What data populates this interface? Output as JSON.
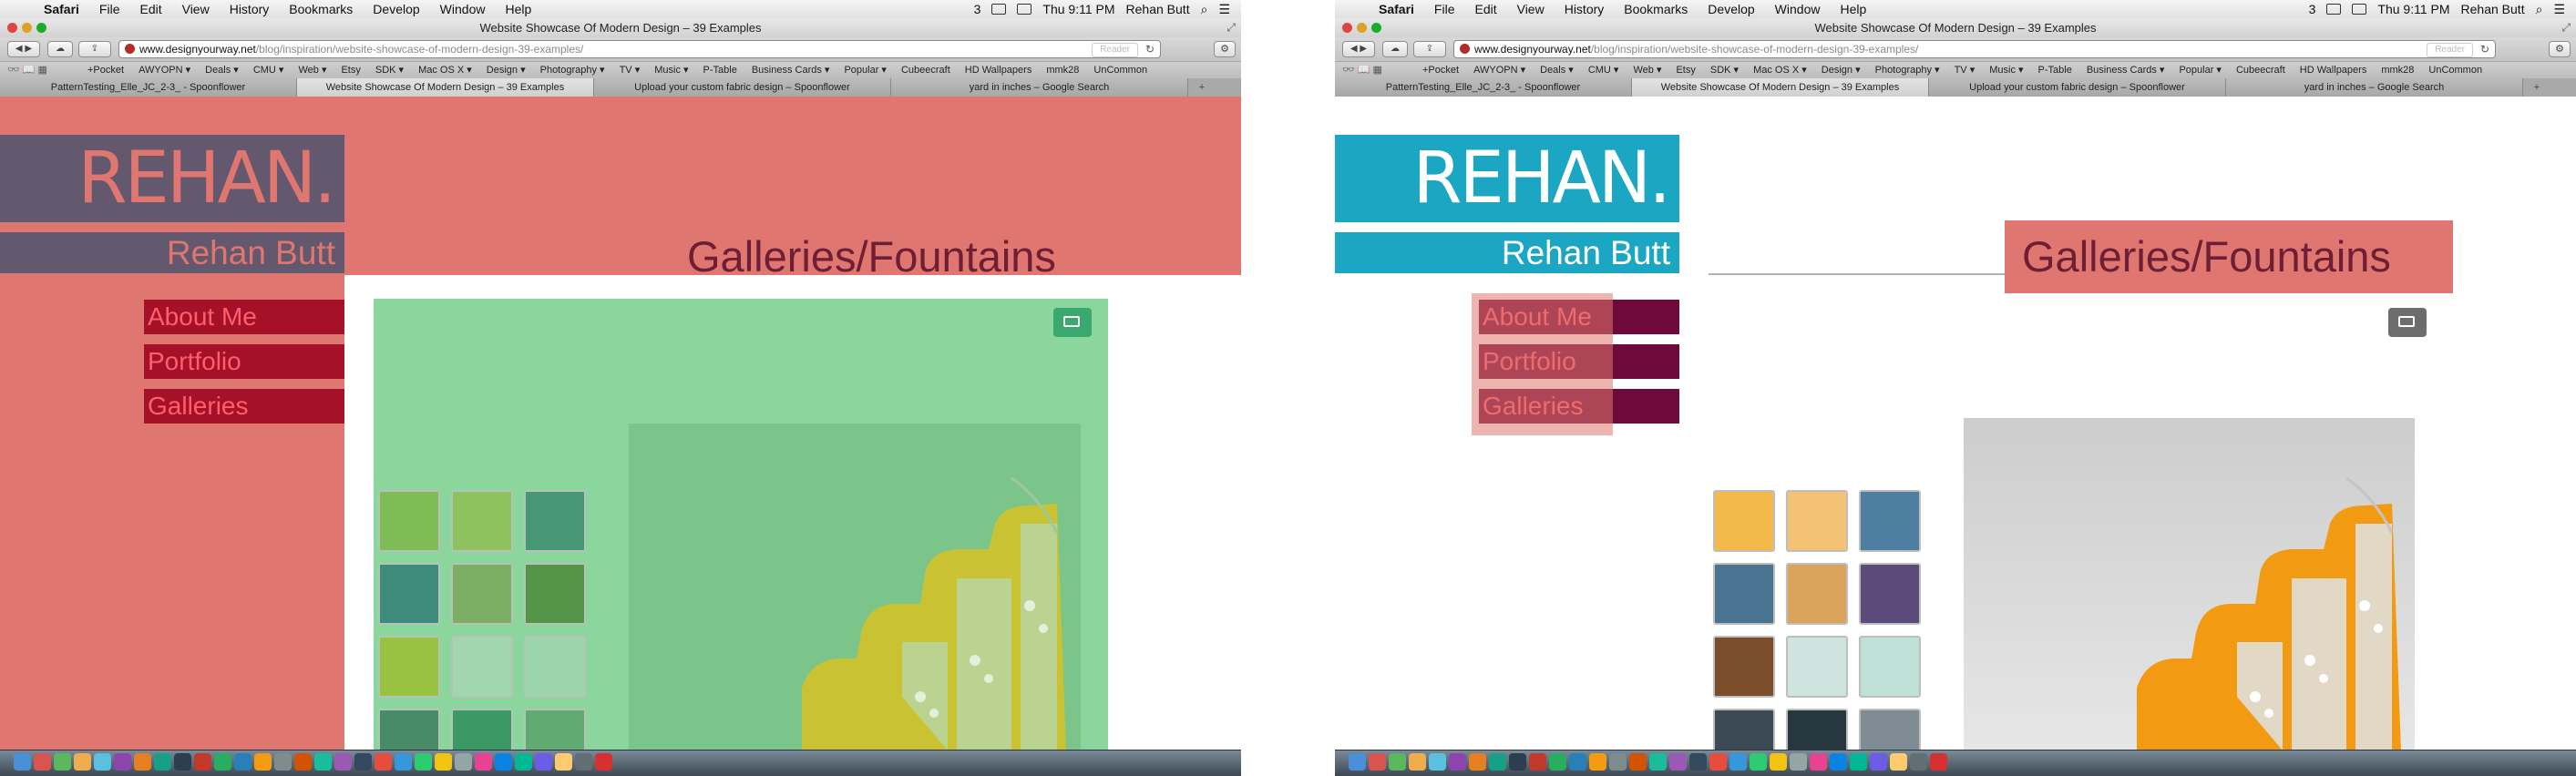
{
  "colors": {
    "salmon_overlay": "#e07670",
    "green_overlay": "#63c97d",
    "brand_grey": "#63586e",
    "brand_teal": "#1ba6c4",
    "nav_red": "#a6112a",
    "nav_maroon": "#70093b",
    "nav_text": "#ff5f6d",
    "title_text": "#6e1f35",
    "expand_green": "#3aa96f",
    "expand_grey": "#6d6d6d"
  },
  "menubar": {
    "apple": "",
    "items": [
      "Safari",
      "File",
      "Edit",
      "View",
      "History",
      "Bookmarks",
      "Develop",
      "Window",
      "Help"
    ],
    "status_extra": "3",
    "clock": "Thu 9:11 PM",
    "user": "Rehan Butt"
  },
  "window": {
    "title": "Website Showcase Of Modern Design – 39 Examples"
  },
  "toolbar": {
    "url_domain": "www.designyourway.net",
    "url_path": "/blog/inspiration/website-showcase-of-modern-design-39-examples/",
    "reader_label": "Reader"
  },
  "bookmarks": [
    "+Pocket",
    "AWYOPN ▾",
    "Deals ▾",
    "CMU ▾",
    "Web ▾",
    "Etsy",
    "SDK ▾",
    "Mac OS X ▾",
    "Design ▾",
    "Photography ▾",
    "TV ▾",
    "Music ▾",
    "P-Table",
    "Business Cards ▾",
    "Popular ▾",
    "Cubeecraft",
    "HD Wallpapers",
    "mmk28",
    "UnCommon"
  ],
  "tabs": [
    "PatternTesting_Elle_JC_2-3_ - Spoonflower",
    "Website Showcase Of Modern Design – 39 Examples",
    "Upload your custom fabric design – Spoonflower",
    "yard in inches – Google Search"
  ],
  "site": {
    "logo": "REHAN.",
    "name": "Rehan Butt",
    "nav": [
      "About Me",
      "Portfolio",
      "Galleries"
    ],
    "gallery_title": "Galleries/Fountains"
  }
}
